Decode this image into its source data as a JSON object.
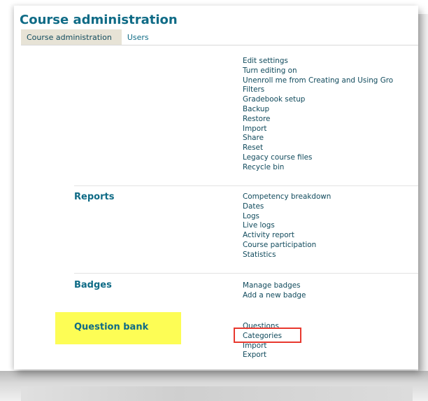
{
  "title": "Course administration",
  "tabs": [
    {
      "label": "Course administration",
      "active": true
    },
    {
      "label": "Users",
      "active": false
    }
  ],
  "course_links": [
    "Edit settings",
    "Turn editing on",
    "Unenroll me from Creating and Using Gro",
    "Filters",
    "Gradebook setup",
    "Backup",
    "Restore",
    "Import",
    "Share",
    "Reset",
    "Legacy course files",
    "Recycle bin"
  ],
  "reports": {
    "heading": "Reports",
    "links": [
      "Competency breakdown",
      "Dates",
      "Logs",
      "Live logs",
      "Activity report",
      "Course participation",
      "Statistics"
    ]
  },
  "badges": {
    "heading": "Badges",
    "links": [
      "Manage badges",
      "Add a new badge"
    ]
  },
  "question_bank": {
    "heading": "Question bank",
    "links": [
      "Questions",
      "Categories",
      "Import",
      "Export"
    ]
  },
  "colors": {
    "heading": "#0f6b86",
    "link": "#104a5c",
    "active_tab_bg": "#e7e3d6",
    "highlight": "#fdfd55",
    "annotation_border": "#e8382e"
  }
}
